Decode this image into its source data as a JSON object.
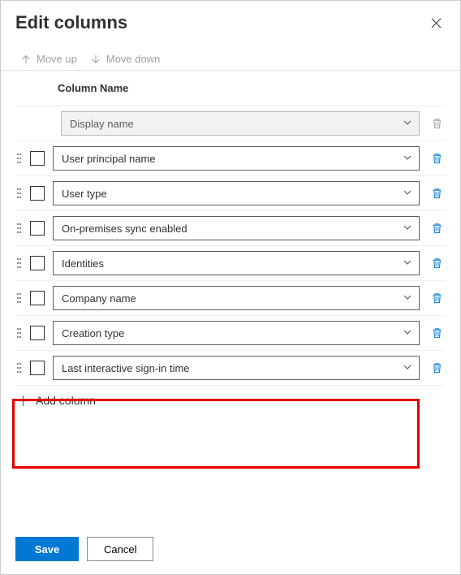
{
  "title": "Edit columns",
  "toolbar": {
    "move_up": "Move up",
    "move_down": "Move down"
  },
  "column_header": "Column Name",
  "columns": [
    {
      "label": "Display name",
      "locked": true
    },
    {
      "label": "User principal name",
      "locked": false
    },
    {
      "label": "User type",
      "locked": false
    },
    {
      "label": "On-premises sync enabled",
      "locked": false
    },
    {
      "label": "Identities",
      "locked": false
    },
    {
      "label": "Company name",
      "locked": false
    },
    {
      "label": "Creation type",
      "locked": false
    },
    {
      "label": "Last interactive sign-in time",
      "locked": false
    }
  ],
  "add_column": "Add column",
  "footer": {
    "save": "Save",
    "cancel": "Cancel"
  },
  "colors": {
    "accent": "#0078d4",
    "highlight": "#e20000"
  }
}
